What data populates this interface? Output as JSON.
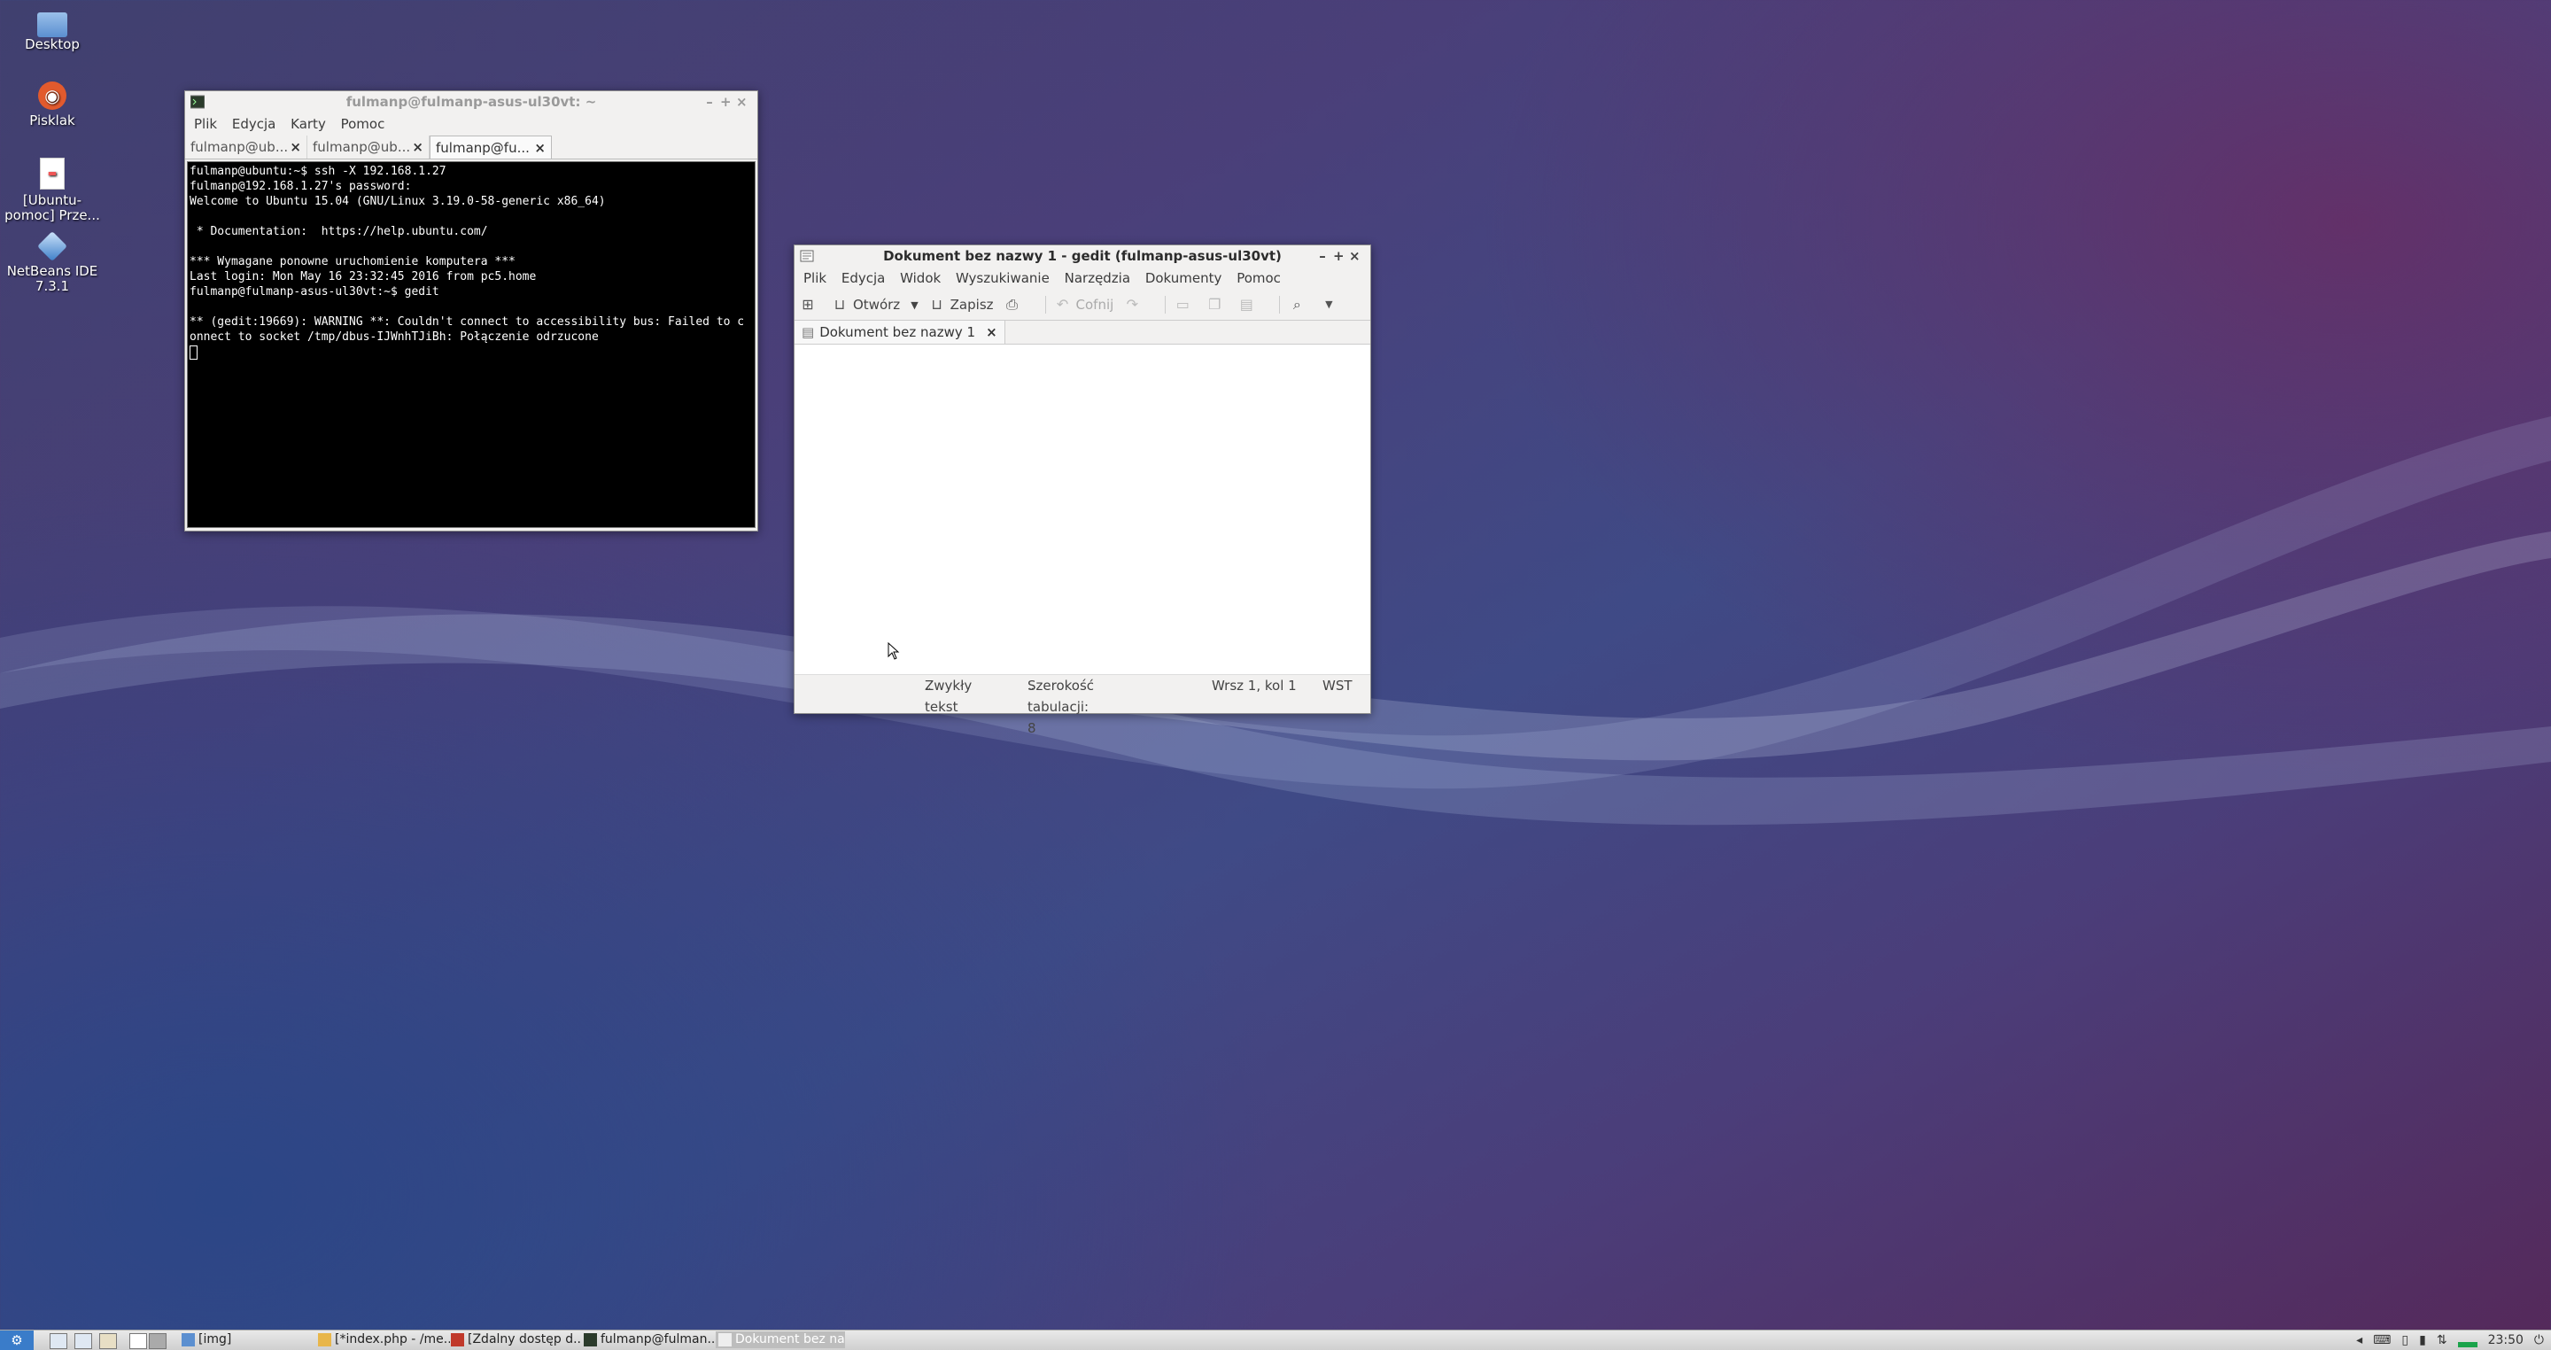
{
  "desktop": {
    "icons": [
      {
        "label": "Desktop"
      },
      {
        "label": "Pisklak"
      },
      {
        "label_line1": "[Ubuntu-",
        "label_line2": "pomoc] Prze..."
      },
      {
        "label_line1": "NetBeans IDE",
        "label_line2": "7.3.1"
      }
    ]
  },
  "terminal": {
    "title": "fulmanp@fulmanp-asus-ul30vt: ~",
    "menu": [
      "Plik",
      "Edycja",
      "Karty",
      "Pomoc"
    ],
    "tabs": [
      "fulmanp@ub...",
      "fulmanp@ub...",
      "fulmanp@fu..."
    ],
    "lines": [
      "fulmanp@ubuntu:~$ ssh -X 192.168.1.27",
      "fulmanp@192.168.1.27's password:",
      "Welcome to Ubuntu 15.04 (GNU/Linux 3.19.0-58-generic x86_64)",
      "",
      " * Documentation:  https://help.ubuntu.com/",
      "",
      "*** Wymagane ponowne uruchomienie komputera ***",
      "Last login: Mon May 16 23:32:45 2016 from pc5.home",
      "fulmanp@fulmanp-asus-ul30vt:~$ gedit",
      "",
      "** (gedit:19669): WARNING **: Couldn't connect to accessibility bus: Failed to c",
      "onnect to socket /tmp/dbus-IJWnhTJiBh: Połączenie odrzucone"
    ]
  },
  "gedit": {
    "title": "Dokument bez nazwy 1 - gedit (fulmanp-asus-ul30vt)",
    "menu": [
      "Plik",
      "Edycja",
      "Widok",
      "Wyszukiwanie",
      "Narzędzia",
      "Dokumenty",
      "Pomoc"
    ],
    "toolbar": {
      "open": "Otwórz",
      "save": "Zapisz",
      "undo": "Cofnij"
    },
    "doc_tab": "Dokument bez nazwy 1",
    "status": {
      "highlight": "Zwykły tekst",
      "tab_width": "Szerokość tabulacji: 8",
      "position": "Wrsz 1, kol 1",
      "mode": "WST"
    }
  },
  "taskbar": {
    "tasks": [
      "[img]",
      "[*index.php - /me...",
      "[Zdalny dostęp d...",
      "fulmanp@fulman...",
      "Dokument bez na..."
    ],
    "clock": "23:50"
  }
}
